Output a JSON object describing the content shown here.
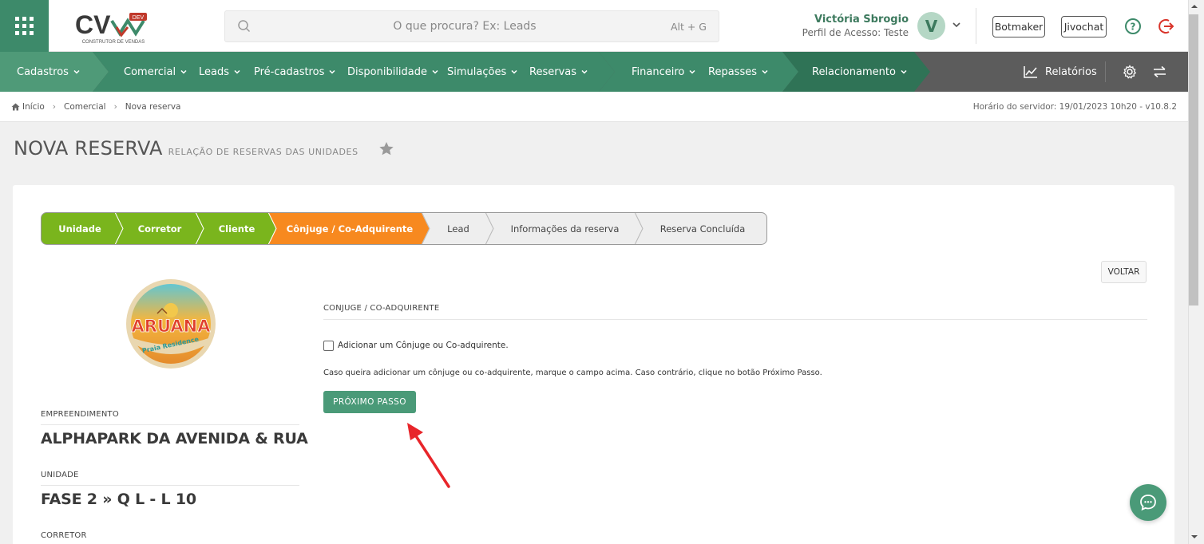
{
  "header": {
    "logo": {
      "text": "CV",
      "badge": "DEV",
      "tagline": "CONSTRUTOR DE VENDAS"
    },
    "search": {
      "placeholder": "O que procura? Ex: Leads",
      "shortcut": "Alt + G"
    },
    "user": {
      "name": "Victória Sbrogio",
      "role": "Perfil de Acesso: Teste",
      "initial": "V"
    },
    "buttons": {
      "botmaker": "Botmaker",
      "jivochat": "Jivochat"
    },
    "icons": [
      "grid-menu-icon",
      "search-icon",
      "chevron-down-icon",
      "help-icon",
      "logout-icon"
    ]
  },
  "nav": {
    "items": [
      {
        "label": "Cadastros"
      },
      {
        "label": "Comercial"
      },
      {
        "label": "Leads"
      },
      {
        "label": "Pré-cadastros"
      },
      {
        "label": "Disponibilidade"
      },
      {
        "label": "Simulações"
      },
      {
        "label": "Reservas"
      },
      {
        "label": "Financeiro"
      },
      {
        "label": "Repasses"
      },
      {
        "label": "Relacionamento"
      }
    ],
    "reports": "Relatórios",
    "colors": {
      "main": "#3d8a6a",
      "gray": "#5c5c5c"
    }
  },
  "breadcrumb": {
    "items": [
      "Início",
      "Comercial",
      "Nova reserva"
    ],
    "server": "Horário do servidor: 19/01/2023 10h20 - v10.8.2"
  },
  "page": {
    "title": "NOVA RESERVA",
    "subtitle": "RELAÇÃO DE RESERVAS DAS UNIDADES"
  },
  "steps": [
    {
      "label": "Unidade",
      "state": "done"
    },
    {
      "label": "Corretor",
      "state": "done"
    },
    {
      "label": "Cliente",
      "state": "done"
    },
    {
      "label": "Cônjuge / Co-Adquirente",
      "state": "current"
    },
    {
      "label": "Lead",
      "state": "pending"
    },
    {
      "label": "Informações da reserva",
      "state": "pending"
    },
    {
      "label": "Reserva Concluída",
      "state": "pending"
    }
  ],
  "step_colors": {
    "done": "#7ab51d",
    "current": "#f7891f",
    "pending": "#eeeeee"
  },
  "voltar": "VOLTAR",
  "emblem": {
    "title": "ARUANA",
    "subtitle": "Praia Residence"
  },
  "info": {
    "empreendimento_label": "EMPREENDIMENTO",
    "empreendimento_value": "ALPHAPARK DA AVENIDA & RUA",
    "unidade_label": "UNIDADE",
    "unidade_value": "FASE 2 » Q L - L 10",
    "corretor_label": "CORRETOR"
  },
  "form": {
    "section_title": "CONJUGE / CO-ADQUIRENTE",
    "checkbox_label": "Adicionar um Cônjuge ou Co-adquirente.",
    "checkbox_checked": false,
    "hint": "Caso queira adicionar um cônjuge ou co-adquirente, marque o campo acima. Caso contrário, clique no botão Próximo Passo.",
    "next_button": "PRÓXIMO PASSO"
  }
}
